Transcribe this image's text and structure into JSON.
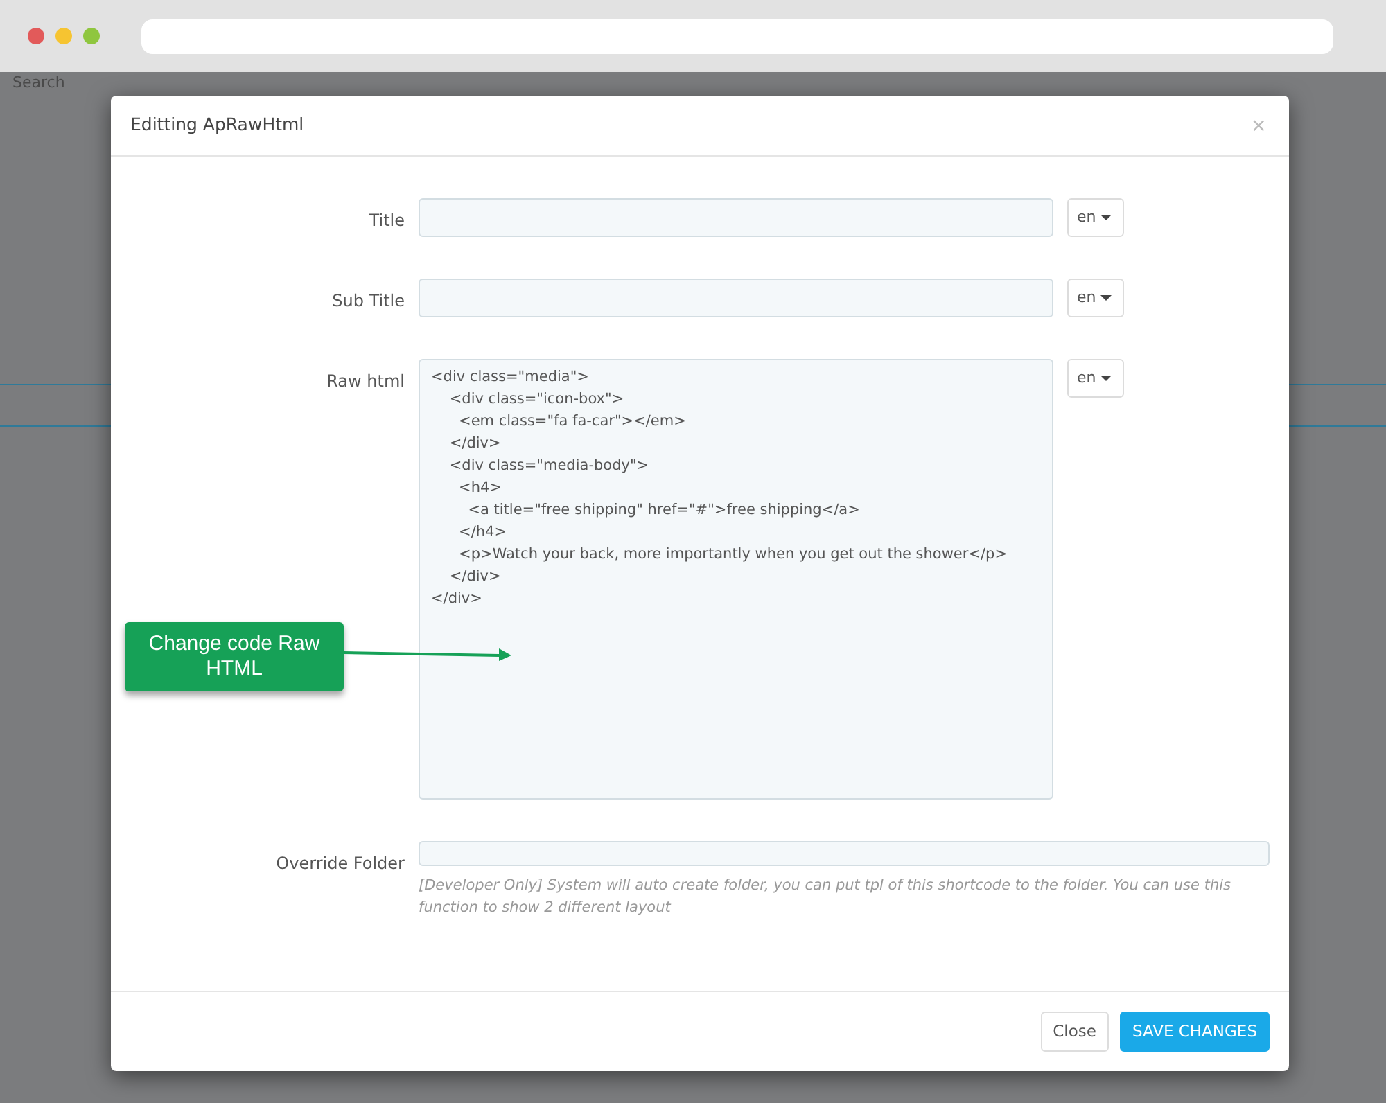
{
  "background": {
    "search_label": "Search"
  },
  "modal": {
    "title": "Editting ApRawHtml",
    "close": "×",
    "fields": [
      {
        "kind": "text",
        "label": "Title",
        "language": "en"
      },
      {
        "kind": "text",
        "label": "Sub Title",
        "language": "en"
      },
      {
        "kind": "textarea",
        "label": "Raw html",
        "language": "en",
        "value": "<div class=\"media\">\n    <div class=\"icon-box\">\n      <em class=\"fa fa-car\"></em>\n    </div>\n    <div class=\"media-body\">\n      <h4>\n        <a title=\"free shipping\" href=\"#\">free shipping</a>\n      </h4>\n      <p>Watch your back, more importantly when you get out the shower</p>\n    </div>\n</div>"
      },
      {
        "kind": "text",
        "label": "Override Folder",
        "help": "[Developer Only] System will auto create folder, you can put tpl of this shortcode to the folder. You can use this function to show 2 different layout"
      }
    ],
    "buttons": [
      {
        "label": "Close",
        "kind": "default"
      },
      {
        "label": "SAVE CHANGES",
        "kind": "primary"
      }
    ]
  },
  "callout": {
    "text": "Change code Raw HTML"
  }
}
